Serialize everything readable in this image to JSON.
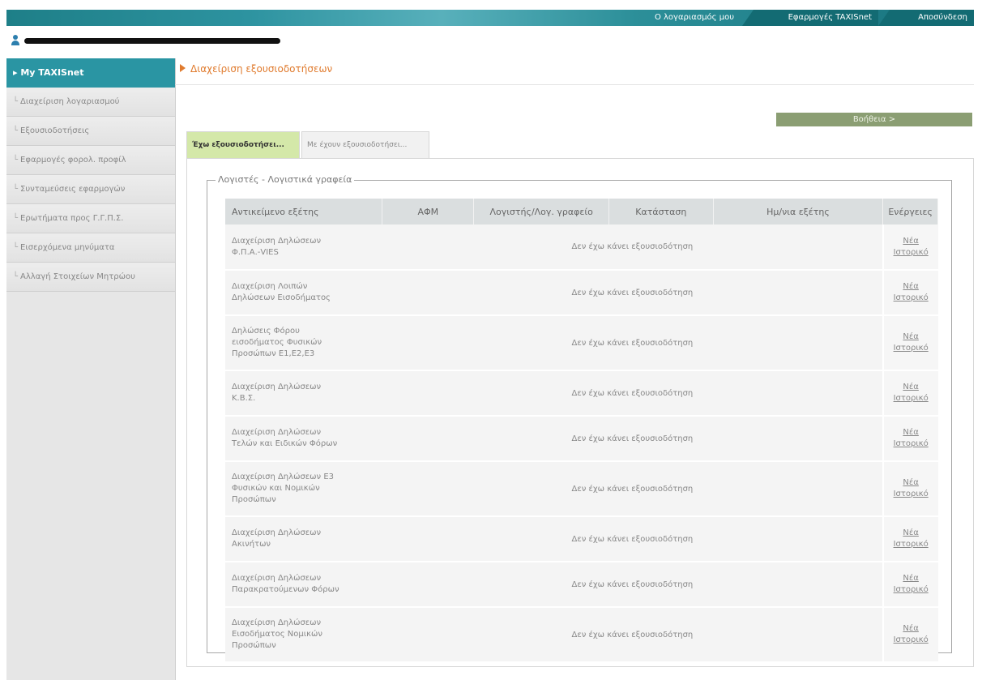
{
  "top_nav": {
    "account": "Ο λογαριασμός μου",
    "apps": "Εφαρμογές TAXISnet",
    "logout": "Αποσύνδεση"
  },
  "sidebar": {
    "header": "My TAXISnet",
    "items": [
      "Διαχείριση λογαριασμού",
      "Εξουσιοδοτήσεις",
      "Εφαρμογές φορολ. προφίλ",
      "Συνταμεύσεις εφαρμογών",
      "Ερωτήματα προς Γ.Γ.Π.Σ.",
      "Εισερχόμενα μηνύματα",
      "Αλλαγή Στοιχείων Μητρώου"
    ]
  },
  "main": {
    "title": "Διαχείριση εξουσιοδοτήσεων",
    "help_label": "Βοήθεια >",
    "tabs": [
      "Έχω εξουσιοδοτήσει...",
      "Με έχουν εξουσιοδοτήσει..."
    ],
    "fieldset_legend": "Λογιστές - Λογιστικά γραφεία",
    "table": {
      "headers": [
        "Αντικείμενο εξέτης",
        "ΑΦΜ",
        "Λογιστής/Λογ. γραφείο",
        "Κατάσταση",
        "Ημ/νια εξέτης",
        "Ενέργειες"
      ],
      "rows": [
        {
          "subject": [
            "Διαχείριση Δηλώσεων",
            "Φ.Π.Α.-VIES"
          ],
          "status": "Δεν έχω κάνει εξουσιοδότηση",
          "action_new": "Νέα",
          "action_history": "Ιστορικό"
        },
        {
          "subject": [
            "Διαχείριση Λοιπών",
            "Δηλώσεων Εισοδήματος"
          ],
          "status": "Δεν έχω κάνει εξουσιοδότηση",
          "action_new": "Νέα",
          "action_history": "Ιστορικό"
        },
        {
          "subject": [
            "Δηλώσεις Φόρου",
            "εισοδήματος Φυσικών",
            "Προσώπων Ε1,Ε2,Ε3"
          ],
          "status": "Δεν έχω κάνει εξουσιοδότηση",
          "action_new": "Νέα",
          "action_history": "Ιστορικό"
        },
        {
          "subject": [
            "Διαχείριση Δηλώσεων",
            "Κ.Β.Σ."
          ],
          "status": "Δεν έχω κάνει εξουσιοδότηση",
          "action_new": "Νέα",
          "action_history": "Ιστορικό"
        },
        {
          "subject": [
            "Διαχείριση Δηλώσεων",
            "Τελών και Ειδικών Φόρων"
          ],
          "status": "Δεν έχω κάνει εξουσιοδότηση",
          "action_new": "Νέα",
          "action_history": "Ιστορικό"
        },
        {
          "subject": [
            "Διαχείριση Δηλώσεων Ε3",
            "Φυσικών και Νομικών",
            "Προσώπων"
          ],
          "status": "Δεν έχω κάνει εξουσιοδότηση",
          "action_new": "Νέα",
          "action_history": "Ιστορικό"
        },
        {
          "subject": [
            "Διαχείριση Δηλώσεων",
            "Ακινήτων"
          ],
          "status": "Δεν έχω κάνει εξουσιοδότηση",
          "action_new": "Νέα",
          "action_history": "Ιστορικό"
        },
        {
          "subject": [
            "Διαχείριση Δηλώσεων",
            "Παρακρατούμενων Φόρων"
          ],
          "status": "Δεν έχω κάνει εξουσιοδότηση",
          "action_new": "Νέα",
          "action_history": "Ιστορικό"
        },
        {
          "subject": [
            "Διαχείριση Δηλώσεων",
            "Εισοδήματος Νομικών",
            "Προσώπων"
          ],
          "status": "Δεν έχω κάνει εξουσιοδότηση",
          "action_new": "Νέα",
          "action_history": "Ιστορικό"
        }
      ]
    }
  },
  "colors": {
    "brand_teal": "#2a95a3",
    "title_orange": "#e07b2e",
    "help_green": "#8b9e73",
    "active_tab": "#d4e8a9"
  }
}
